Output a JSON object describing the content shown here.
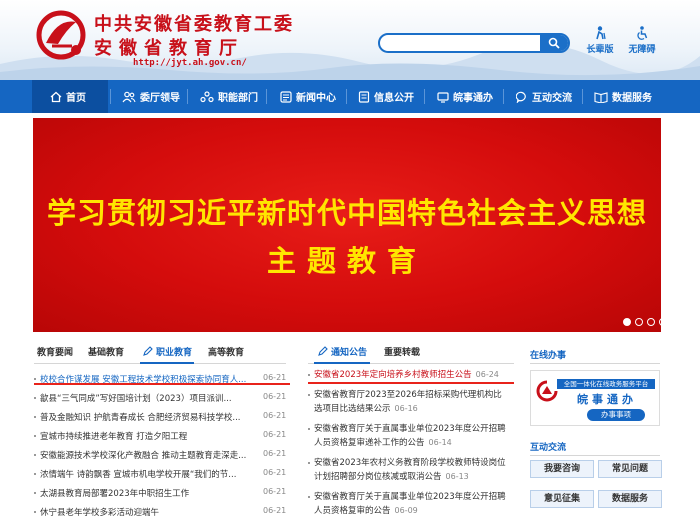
{
  "header": {
    "title_line1": "中共安徽省委教育工委",
    "title_line2": "安徽省教育厅",
    "url": "http://jyt.ah.gov.cn/",
    "search_placeholder": "",
    "tools": [
      {
        "label": "长辈版",
        "icon": "elder-icon"
      },
      {
        "label": "无障碍",
        "icon": "accessibility-icon"
      }
    ]
  },
  "nav": {
    "items": [
      {
        "label": "首页",
        "icon": "home-icon"
      },
      {
        "label": "委厅领导",
        "icon": "leaders-icon"
      },
      {
        "label": "职能部门",
        "icon": "departments-icon"
      },
      {
        "label": "新闻中心",
        "icon": "news-icon"
      },
      {
        "label": "信息公开",
        "icon": "info-icon"
      },
      {
        "label": "皖事通办",
        "icon": "service-icon"
      },
      {
        "label": "互动交流",
        "icon": "chat-icon"
      },
      {
        "label": "数据服务",
        "icon": "data-icon"
      }
    ]
  },
  "banner": {
    "line1": "学习贯彻习近平新时代中国特色社会主义思想",
    "line2": "主题教育",
    "slides": 5,
    "active_slide": 1
  },
  "education": {
    "tabs": [
      "教育要闻",
      "基础教育",
      "职业教育",
      "高等教育"
    ],
    "active_tab": 2,
    "items": [
      {
        "title": "校校合作谋发展 安徽工程技术学校积极探索协同育人...",
        "date": "06-21"
      },
      {
        "title": "歙县“三气同成”写好国培计划（2023）项目派训...",
        "date": "06-21"
      },
      {
        "title": "普及金融知识 护航青春成长 合肥经济贸易科技学校...",
        "date": "06-21"
      },
      {
        "title": "宣城市持续推进老年教育 打造夕阳工程",
        "date": "06-21"
      },
      {
        "title": "安徽能源技术学校深化产教融合 推动主题教育走深走...",
        "date": "06-21"
      },
      {
        "title": "浓情端午 诗韵飘香 宣城市机电学校开展“我们的节...",
        "date": "06-21"
      },
      {
        "title": "太湖县教育局部署2023年中职招生工作",
        "date": "06-21"
      },
      {
        "title": "休宁县老年学校多彩活动迎端午",
        "date": "06-21"
      }
    ]
  },
  "notices": {
    "tabs": [
      "通知公告",
      "重要转载"
    ],
    "active_tab": 0,
    "items": [
      {
        "lines": [
          "安徽省2023年定向培养乡村教师招生公告"
        ],
        "date": "06-24"
      },
      {
        "lines": [
          "安徽省教育厅2023至2026年招标采购代理机构比",
          "选项目比选结果公示"
        ],
        "date": "06-16"
      },
      {
        "lines": [
          "安徽省教育厅关于直属事业单位2023年度公开招聘",
          "人员资格复审递补工作的公告"
        ],
        "date": "06-14"
      },
      {
        "lines": [
          "安徽省2023年农村义务教育阶段学校教师特设岗位",
          "计划招聘部分岗位核减或取消公告"
        ],
        "date": "06-13"
      },
      {
        "lines": [
          "安徽省教育厅关于直属事业单位2023年度公开招聘",
          "人员资格复审的公告"
        ],
        "date": "06-09"
      }
    ]
  },
  "sidebar": {
    "service_title": "在线办事",
    "service_bar": "全国一体化在线政务服务平台",
    "service_name": "皖事通办",
    "service_button": "办事事项",
    "interact_title": "互动交流",
    "buttons": [
      "我要咨询",
      "常见问题",
      "意见征集",
      "数据服务"
    ]
  },
  "colors": {
    "brand_blue": "#1566c2",
    "title_red": "#c8101a",
    "banner_red": "#d40c0c",
    "banner_text": "#ffe600"
  }
}
